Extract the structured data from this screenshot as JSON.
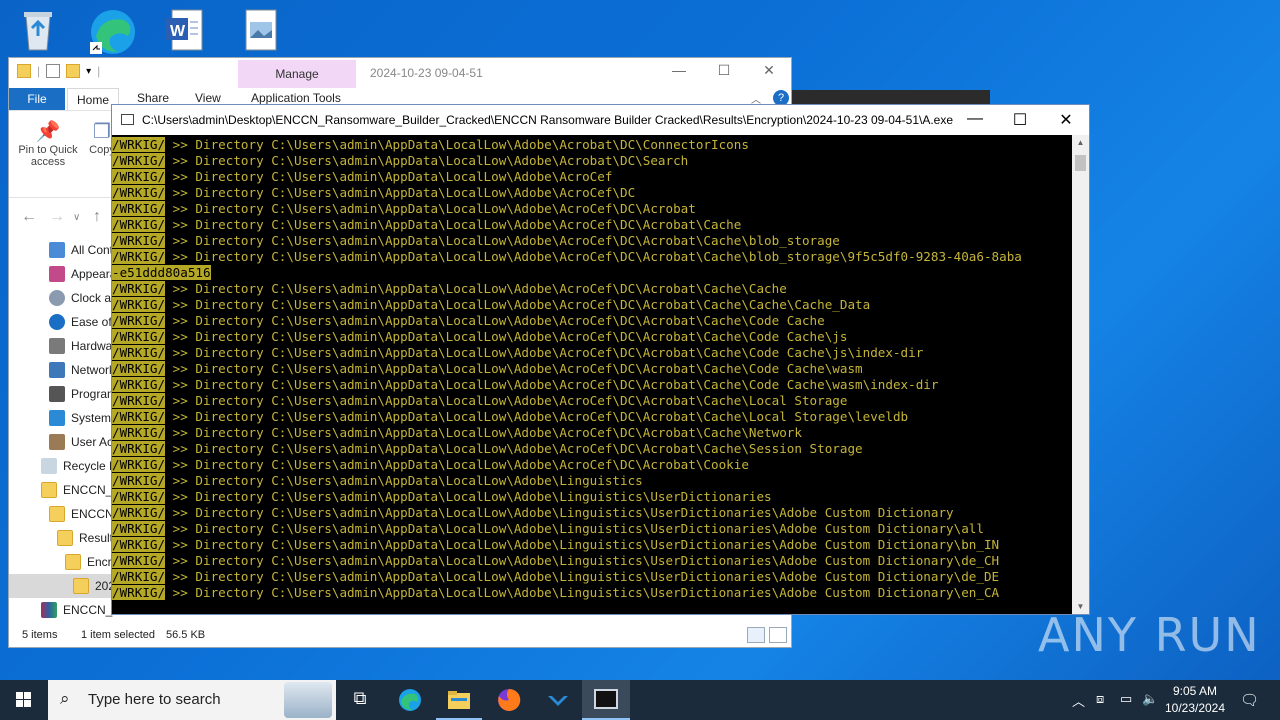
{
  "desktop": {
    "icons": [
      "recycle-bin",
      "microsoft-edge",
      "word-document",
      "image-file"
    ]
  },
  "explorer": {
    "manage_tab": "Manage",
    "title": "2024-10-23 09-04-51",
    "ribbon_tabs": {
      "file": "File",
      "home": "Home",
      "share": "Share",
      "view": "View",
      "app_tools": "Application Tools"
    },
    "ribbon_buttons": {
      "pin": "Pin to Quick access",
      "copy": "Copy"
    },
    "tree": [
      "All Cont",
      "Appeara",
      "Clock ar",
      "Ease of A",
      "Hardwa",
      "Network",
      "Program",
      "System",
      "User Acc",
      "Recycle B",
      "ENCCN_R",
      "ENCCN",
      "Results",
      "Encry",
      "202",
      "ENCCN_R"
    ],
    "status": {
      "items": "5 items",
      "selected": "1 item selected",
      "size": "56.5 KB"
    }
  },
  "console": {
    "title": "C:\\Users\\admin\\Desktop\\ENCCN_Ransomware_Builder_Cracked\\ENCCN Ransomware Builder Cracked\\Results\\Encryption\\2024-10-23 09-04-51\\A.exe",
    "tag": "/WRKIG/",
    "prefix": " >> Directory ",
    "lines": [
      "C:\\Users\\admin\\AppData\\LocalLow\\Adobe\\Acrobat\\DC\\ConnectorIcons",
      "C:\\Users\\admin\\AppData\\LocalLow\\Adobe\\Acrobat\\DC\\Search",
      "C:\\Users\\admin\\AppData\\LocalLow\\Adobe\\AcroCef",
      "C:\\Users\\admin\\AppData\\LocalLow\\Adobe\\AcroCef\\DC",
      "C:\\Users\\admin\\AppData\\LocalLow\\Adobe\\AcroCef\\DC\\Acrobat",
      "C:\\Users\\admin\\AppData\\LocalLow\\Adobe\\AcroCef\\DC\\Acrobat\\Cache",
      "C:\\Users\\admin\\AppData\\LocalLow\\Adobe\\AcroCef\\DC\\Acrobat\\Cache\\blob_storage",
      "C:\\Users\\admin\\AppData\\LocalLow\\Adobe\\AcroCef\\DC\\Acrobat\\Cache\\blob_storage\\9f5c5df0-9283-40a6-8aba",
      "C:\\Users\\admin\\AppData\\LocalLow\\Adobe\\AcroCef\\DC\\Acrobat\\Cache\\Cache",
      "C:\\Users\\admin\\AppData\\LocalLow\\Adobe\\AcroCef\\DC\\Acrobat\\Cache\\Cache\\Cache_Data",
      "C:\\Users\\admin\\AppData\\LocalLow\\Adobe\\AcroCef\\DC\\Acrobat\\Cache\\Code Cache",
      "C:\\Users\\admin\\AppData\\LocalLow\\Adobe\\AcroCef\\DC\\Acrobat\\Cache\\Code Cache\\js",
      "C:\\Users\\admin\\AppData\\LocalLow\\Adobe\\AcroCef\\DC\\Acrobat\\Cache\\Code Cache\\js\\index-dir",
      "C:\\Users\\admin\\AppData\\LocalLow\\Adobe\\AcroCef\\DC\\Acrobat\\Cache\\Code Cache\\wasm",
      "C:\\Users\\admin\\AppData\\LocalLow\\Adobe\\AcroCef\\DC\\Acrobat\\Cache\\Code Cache\\wasm\\index-dir",
      "C:\\Users\\admin\\AppData\\LocalLow\\Adobe\\AcroCef\\DC\\Acrobat\\Cache\\Local Storage",
      "C:\\Users\\admin\\AppData\\LocalLow\\Adobe\\AcroCef\\DC\\Acrobat\\Cache\\Local Storage\\leveldb",
      "C:\\Users\\admin\\AppData\\LocalLow\\Adobe\\AcroCef\\DC\\Acrobat\\Cache\\Network",
      "C:\\Users\\admin\\AppData\\LocalLow\\Adobe\\AcroCef\\DC\\Acrobat\\Cache\\Session Storage",
      "C:\\Users\\admin\\AppData\\LocalLow\\Adobe\\AcroCef\\DC\\Acrobat\\Cookie",
      "C:\\Users\\admin\\AppData\\LocalLow\\Adobe\\Linguistics",
      "C:\\Users\\admin\\AppData\\LocalLow\\Adobe\\Linguistics\\UserDictionaries",
      "C:\\Users\\admin\\AppData\\LocalLow\\Adobe\\Linguistics\\UserDictionaries\\Adobe Custom Dictionary",
      "C:\\Users\\admin\\AppData\\LocalLow\\Adobe\\Linguistics\\UserDictionaries\\Adobe Custom Dictionary\\all",
      "C:\\Users\\admin\\AppData\\LocalLow\\Adobe\\Linguistics\\UserDictionaries\\Adobe Custom Dictionary\\bn_IN",
      "C:\\Users\\admin\\AppData\\LocalLow\\Adobe\\Linguistics\\UserDictionaries\\Adobe Custom Dictionary\\de_CH",
      "C:\\Users\\admin\\AppData\\LocalLow\\Adobe\\Linguistics\\UserDictionaries\\Adobe Custom Dictionary\\de_DE",
      "C:\\Users\\admin\\AppData\\LocalLow\\Adobe\\Linguistics\\UserDictionaries\\Adobe Custom Dictionary\\en_CA"
    ],
    "wrap_continuation": "-e51ddd80a516",
    "wrap_after_index": 7
  },
  "taskbar": {
    "search_placeholder": "Type here to search",
    "time": "9:05 AM",
    "date": "10/23/2024"
  },
  "watermark": "ANY RUN",
  "colors": {
    "console_text": "#c4b43a",
    "tag_bg": "#b5a826",
    "taskbar": "#1b2b3b",
    "desktop": "#0b6fd6"
  }
}
